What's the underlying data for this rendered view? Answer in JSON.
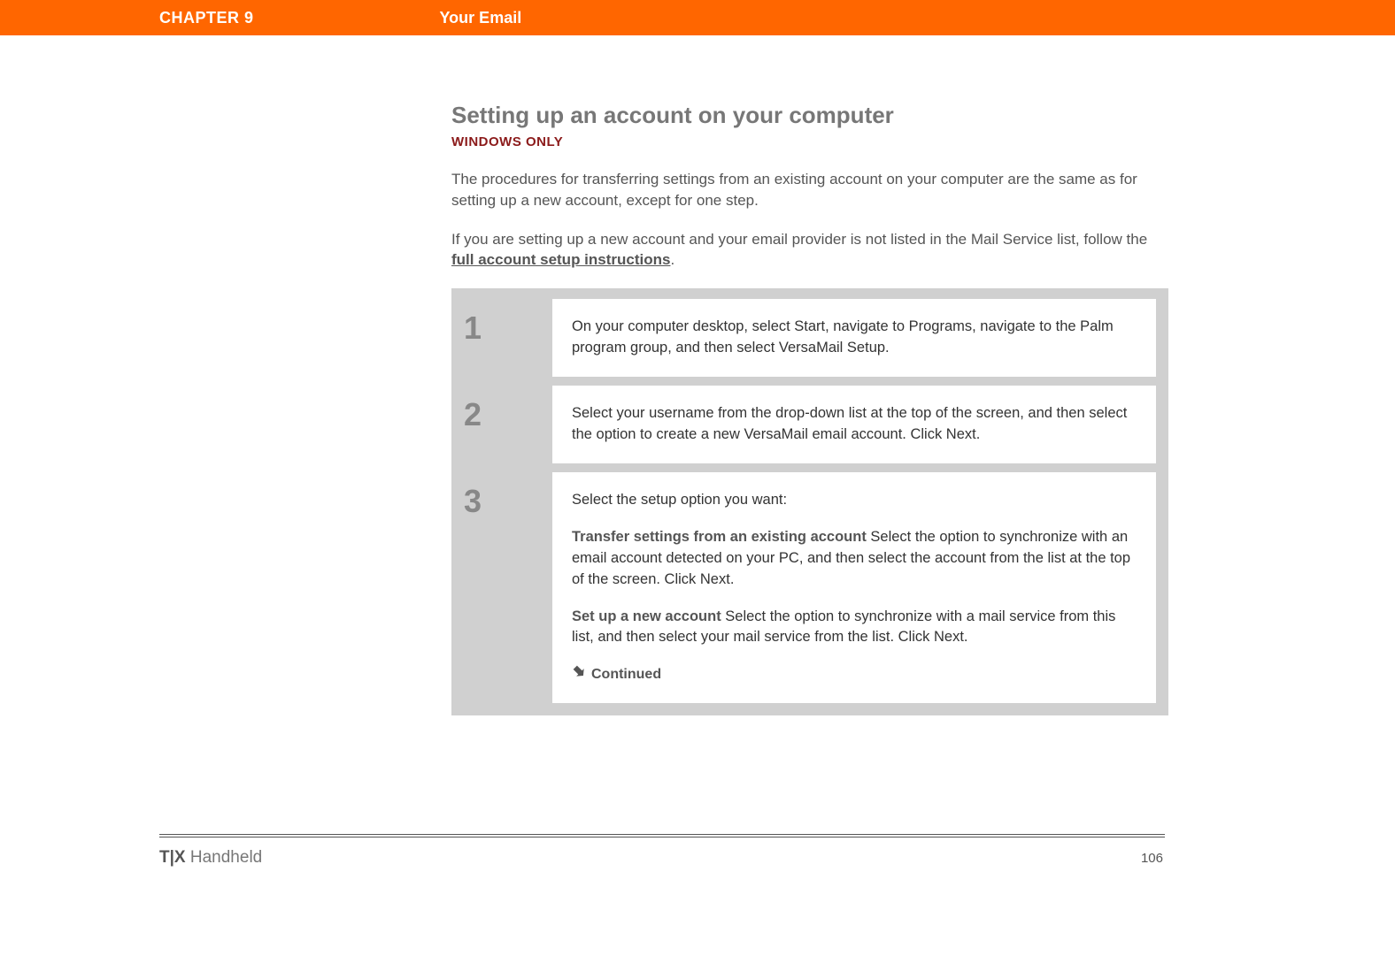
{
  "header": {
    "chapter": "CHAPTER 9",
    "section": "Your Email"
  },
  "title": "Setting up an account on your computer",
  "subtitle": "WINDOWS ONLY",
  "paragraphs": {
    "p1": "The procedures for transferring settings from an existing account on your computer are the same as for setting up a new account, except for one step.",
    "p2_pre": "If you are setting up a new account and your email provider is not listed in the Mail Service list, follow the ",
    "p2_link": "full account setup instructions",
    "p2_post": "."
  },
  "steps": [
    {
      "num": "1",
      "text": "On your computer desktop, select Start, navigate to Programs, navigate to the Palm program group, and then select VersaMail Setup."
    },
    {
      "num": "2",
      "text": "Select your username from the drop-down list at the top of the screen, and then select the option to create a new VersaMail email account. Click Next."
    },
    {
      "num": "3",
      "intro": "Select the setup option you want:",
      "opt1_lead": "Transfer settings from an existing account",
      "opt1_text": "   Select the option to synchronize with an email account detected on your PC, and then select the account from the list at the top of the screen. Click Next.",
      "opt2_lead": "Set up a new account",
      "opt2_text": "   Select the option to synchronize with a mail service from this list, and then select your mail service from the list. Click Next.",
      "continued": "Continued"
    }
  ],
  "footer": {
    "brand_bold": "T|X",
    "brand_rest": " Handheld",
    "page": "106"
  }
}
